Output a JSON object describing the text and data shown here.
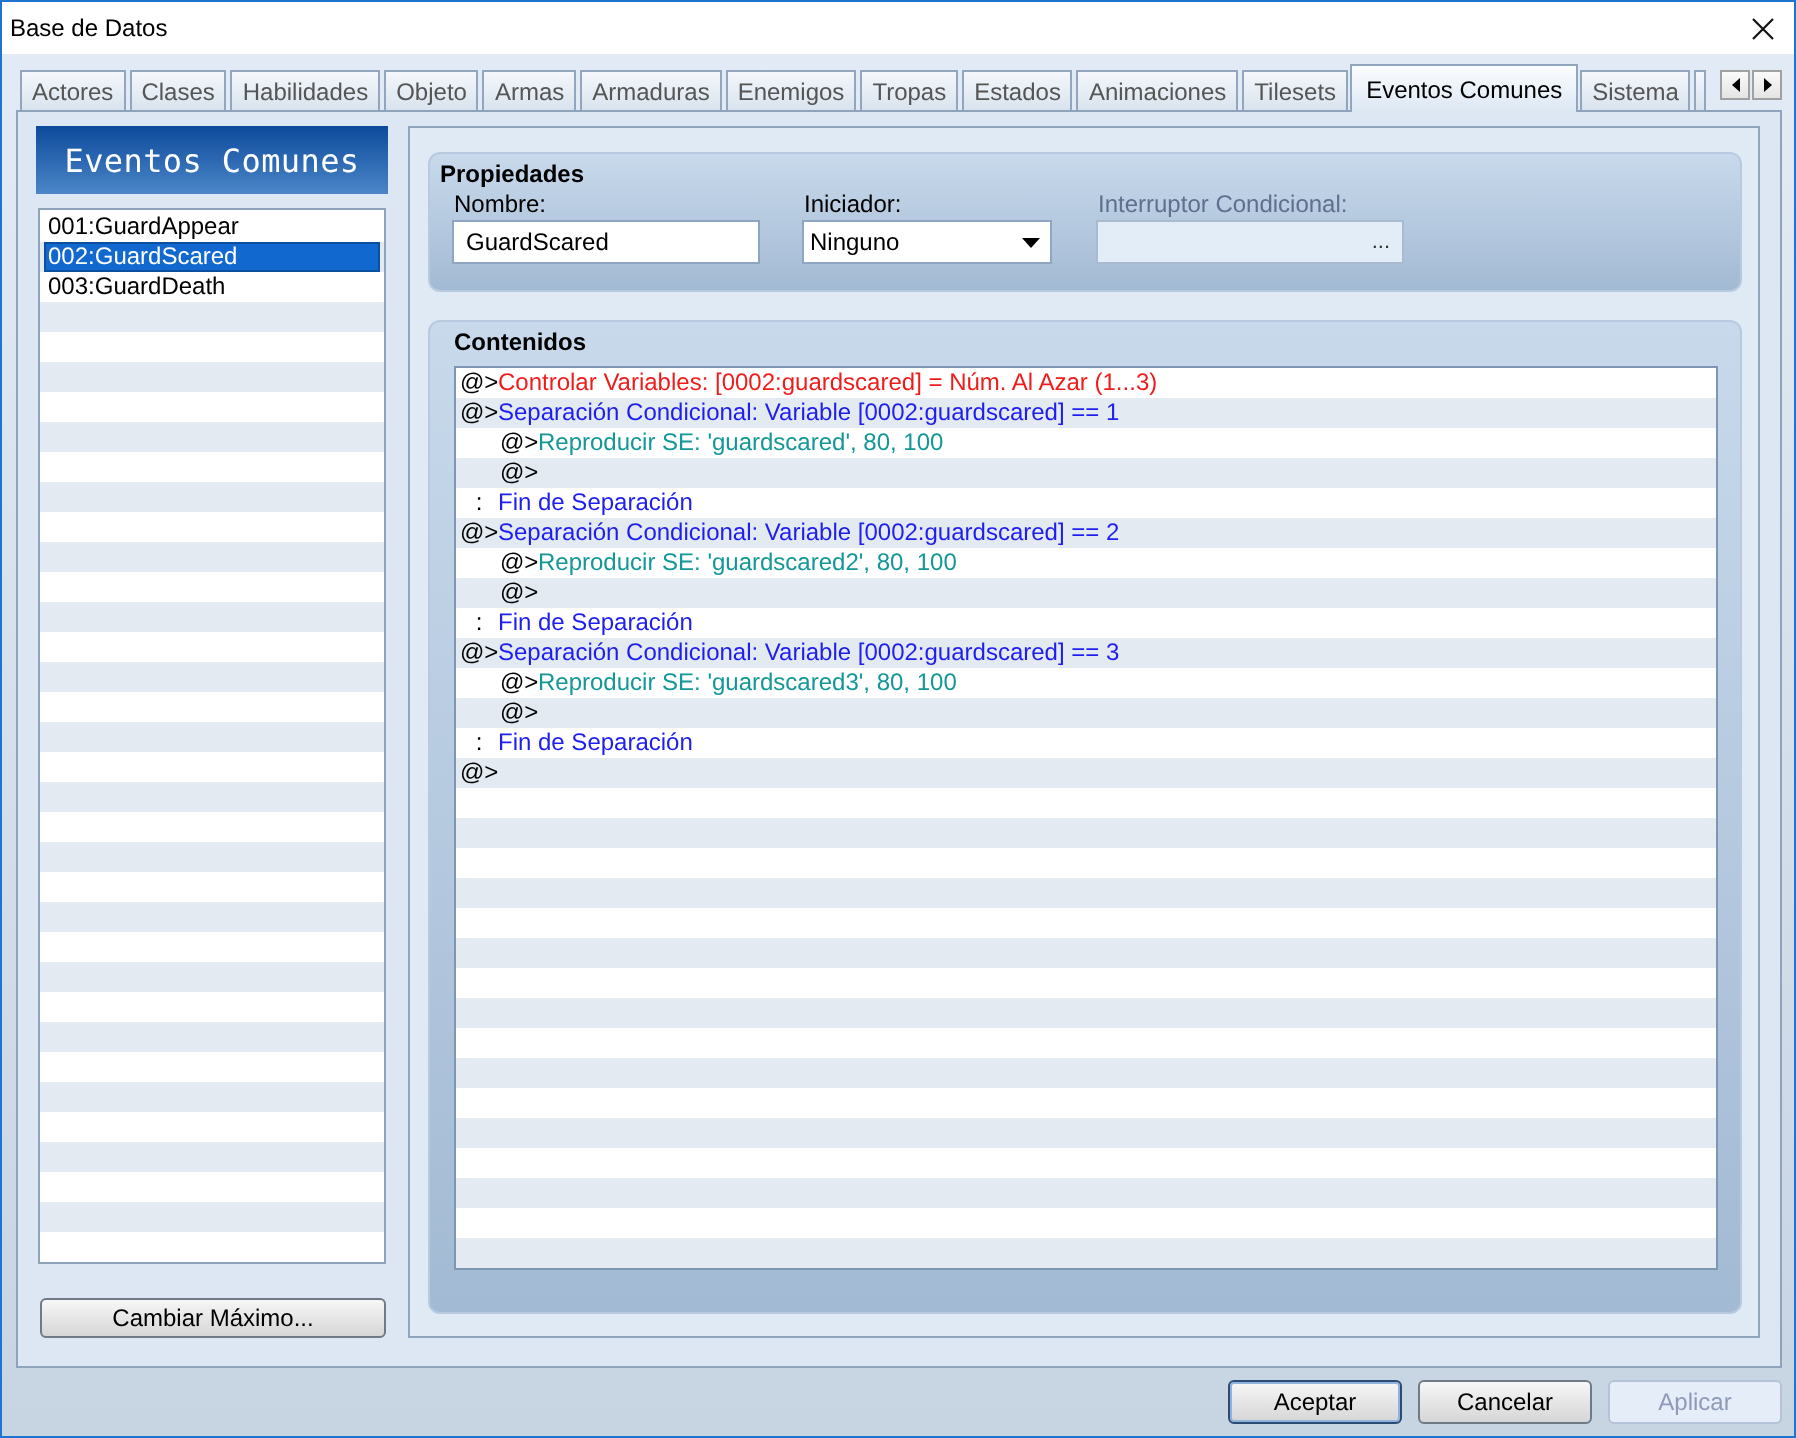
{
  "window": {
    "title": "Base de Datos"
  },
  "tabs": [
    {
      "label": "Actores",
      "selected": false
    },
    {
      "label": "Clases",
      "selected": false
    },
    {
      "label": "Habilidades",
      "selected": false
    },
    {
      "label": "Objeto",
      "selected": false
    },
    {
      "label": "Armas",
      "selected": false
    },
    {
      "label": "Armaduras",
      "selected": false
    },
    {
      "label": "Enemigos",
      "selected": false
    },
    {
      "label": "Tropas",
      "selected": false
    },
    {
      "label": "Estados",
      "selected": false
    },
    {
      "label": "Animaciones",
      "selected": false
    },
    {
      "label": "Tilesets",
      "selected": false
    },
    {
      "label": "Eventos Comunes",
      "selected": true
    },
    {
      "label": "Sistema",
      "selected": false
    }
  ],
  "events": {
    "title": "Eventos Comunes",
    "items": [
      {
        "label": "001:GuardAppear",
        "selected": false
      },
      {
        "label": "002:GuardScared",
        "selected": true
      },
      {
        "label": "003:GuardDeath",
        "selected": false
      }
    ],
    "button": "Cambiar Máximo..."
  },
  "properties": {
    "title": "Propiedades",
    "name": {
      "label": "Nombre:",
      "value": "GuardScared"
    },
    "trigger": {
      "label": "Iniciador:",
      "value": "Ninguno"
    },
    "switch": {
      "label": "Interruptor Condicional:",
      "disabled": true,
      "button": "..."
    }
  },
  "contents": {
    "title": "Contenidos",
    "commands": [
      {
        "kind": "variable",
        "prefix": "@>",
        "text": "Controlar Variables: [0002:guardscared] = Núm. Al Azar (1...3)"
      },
      {
        "kind": "condition",
        "prefix": "@>",
        "text": "Separación Condicional: Variable [0002:guardscared] == 1",
        "children": [
          {
            "kind": "sound",
            "prefix": "@>",
            "text": "Reproducir SE: 'guardscared', 80, 100"
          },
          {
            "kind": "empty",
            "prefix": "@>"
          }
        ]
      },
      {
        "kind": "end",
        "prefix": ":",
        "text": "Fin de Separación"
      },
      {
        "kind": "condition",
        "prefix": "@>",
        "text": "Separación Condicional: Variable [0002:guardscared] == 2",
        "children": [
          {
            "kind": "sound",
            "prefix": "@>",
            "text": "Reproducir SE: 'guardscared2', 80, 100"
          },
          {
            "kind": "empty",
            "prefix": "@>"
          }
        ]
      },
      {
        "kind": "end",
        "prefix": ":",
        "text": "Fin de Separación"
      },
      {
        "kind": "condition",
        "prefix": "@>",
        "text": "Separación Condicional: Variable [0002:guardscared] == 3",
        "children": [
          {
            "kind": "sound",
            "prefix": "@>",
            "text": "Reproducir SE: 'guardscared3', 80, 100"
          },
          {
            "kind": "empty",
            "prefix": "@>"
          }
        ]
      },
      {
        "kind": "end",
        "prefix": ":",
        "text": "Fin de Separación"
      },
      {
        "kind": "empty",
        "prefix": "@>"
      }
    ]
  },
  "buttons": [
    {
      "label": "Aceptar",
      "default": true,
      "disabled": false
    },
    {
      "label": "Cancelar",
      "default": false,
      "disabled": false
    },
    {
      "label": "Aplicar",
      "default": false,
      "disabled": true
    }
  ]
}
